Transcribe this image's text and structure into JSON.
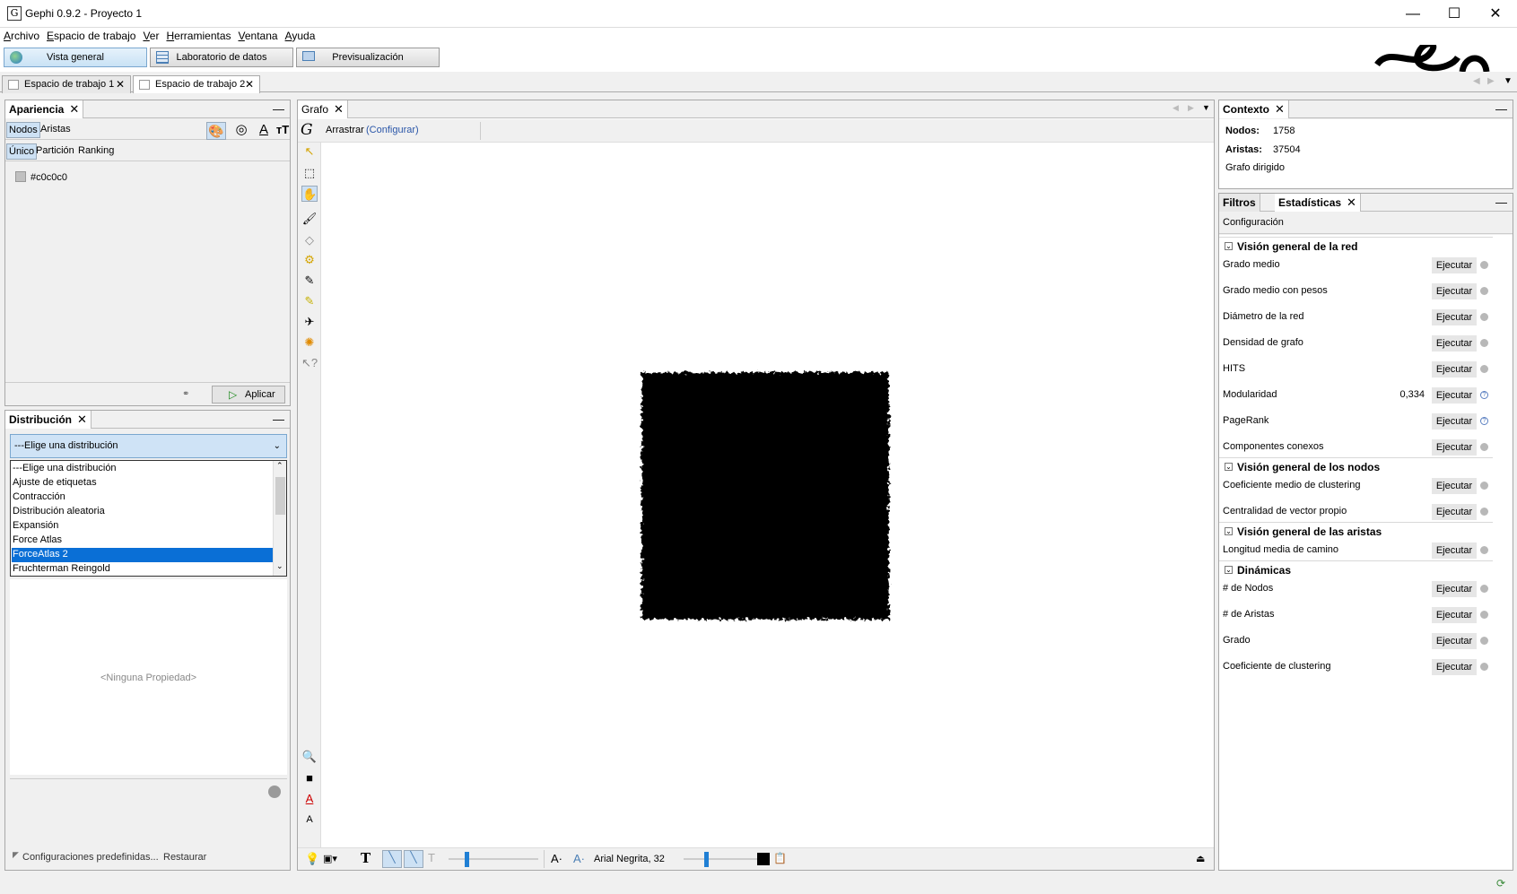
{
  "window": {
    "title": "Gephi 0.9.2 - Proyecto 1",
    "controls": {
      "minimize": "—",
      "maximize": "☐",
      "close": "✕"
    }
  },
  "menu": [
    "Archivo",
    "Espacio de trabajo",
    "Ver",
    "Herramientas",
    "Ventana",
    "Ayuda"
  ],
  "modes": {
    "overview": "Vista general",
    "data_lab": "Laboratorio de datos",
    "preview": "Previsualización"
  },
  "workspaces": [
    {
      "label": "Espacio de trabajo 1",
      "active": false
    },
    {
      "label": "Espacio de trabajo 2",
      "active": true
    }
  ],
  "appearance": {
    "title": "Apariencia",
    "element_tabs": [
      "Nodos",
      "Aristas"
    ],
    "mode_tabs": [
      "Único",
      "Partición",
      "Ranking"
    ],
    "color_value": "#c0c0c0",
    "apply_label": "Aplicar",
    "swatch_color": "#c0c0c0"
  },
  "layout": {
    "title": "Distribución",
    "selected": "---Elige una distribución",
    "options": [
      "---Elige una distribución",
      "Ajuste de etiquetas",
      "Contracción",
      "Distribución aleatoria",
      "Expansión",
      "Force Atlas",
      "ForceAtlas 2",
      "Fruchterman Reingold"
    ],
    "highlighted_option": "ForceAtlas 2",
    "empty_props": "<Ninguna Propiedad>",
    "presets_label": "Configuraciones predefinidas...",
    "restore_label": "Restaurar"
  },
  "graph": {
    "tab": "Grafo",
    "tool_name": "Arrastrar",
    "tool_config": "(Configurar)",
    "font_label": "Arial Negrita, 32"
  },
  "context": {
    "title": "Contexto",
    "nodes_label": "Nodos:",
    "nodes_value": "1758",
    "edges_label": "Aristas:",
    "edges_value": "37504",
    "graph_type": "Grafo dirigido"
  },
  "statistics": {
    "filters_tab": "Filtros",
    "stats_tab": "Estadísticas",
    "config_label": "Configuración",
    "run_label": "Ejecutar",
    "sections": [
      {
        "title": "Visión general de la red",
        "rows": [
          {
            "label": "Grado medio",
            "value": "",
            "info": false
          },
          {
            "label": "Grado medio con pesos",
            "value": "",
            "info": false
          },
          {
            "label": "Diámetro de la red",
            "value": "",
            "info": false
          },
          {
            "label": "Densidad de grafo",
            "value": "",
            "info": false
          },
          {
            "label": "HITS",
            "value": "",
            "info": false
          },
          {
            "label": "Modularidad",
            "value": "0,334",
            "info": true
          },
          {
            "label": "PageRank",
            "value": "",
            "info": true
          },
          {
            "label": "Componentes conexos",
            "value": "",
            "info": false
          }
        ]
      },
      {
        "title": "Visión general de los nodos",
        "rows": [
          {
            "label": "Coeficiente medio de clustering",
            "value": "",
            "info": false
          },
          {
            "label": "Centralidad de vector propio",
            "value": "",
            "info": false
          }
        ]
      },
      {
        "title": "Visión general de las aristas",
        "rows": [
          {
            "label": "Longitud media de camino",
            "value": "",
            "info": false
          }
        ]
      },
      {
        "title": "Dinámicas",
        "rows": [
          {
            "label": "# de Nodos",
            "value": "",
            "info": false
          },
          {
            "label": "# de Aristas",
            "value": "",
            "info": false
          },
          {
            "label": "Grado",
            "value": "",
            "info": false
          },
          {
            "label": "Coeficiente de clustering",
            "value": "",
            "info": false
          }
        ]
      }
    ]
  }
}
